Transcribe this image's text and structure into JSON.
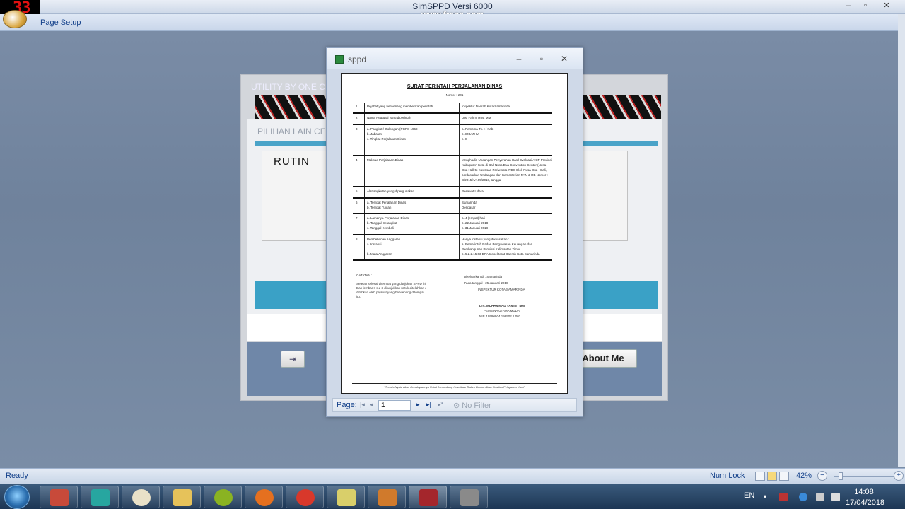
{
  "app": {
    "title": "SimSPPD Versi 6000",
    "overlay": "www.fraps.com",
    "fps": "33",
    "ribbon_tab": "Page Setup"
  },
  "window_controls": {
    "minimize": "–",
    "restore": "▫",
    "close": "✕"
  },
  "background_form": {
    "title": "UTILITY BY ONE CLIC",
    "subtitle": "PILIHAN LAIN CETA",
    "rutin": "RUTIN",
    "about": "About Me"
  },
  "report_window": {
    "title": "sppd",
    "nav": {
      "page_label": "Page:",
      "page_value": "1",
      "filter": "No Filter"
    },
    "document": {
      "title": "SURAT PERINTAH PERJALANAN DINAS",
      "nomor": "Nomor :  201",
      "rows": [
        {
          "no": "1",
          "label": "Pejabat yang berwenang memberikan perintah",
          "value": "Inspektur Daerah Kota Samarinda"
        },
        {
          "no": "2",
          "label": "Nama Pegawai yang diperintah",
          "value": "Drs. Fahmi Ros, MM"
        },
        {
          "no": "3",
          "label": "a. Pangkat / Golongan (PGPS-1968 \nb. Jabatan\nc. Tingkat Perjalanan Dinas",
          "value": "a.   Pembina Tk. I / IV/b\nb.   IRBAN IV\nc.   C"
        },
        {
          "no": "4",
          "label": "Maksud Perjalanan Dinas",
          "value": "Menghadiri Undangan Penyerahan Hasil Evaluasi AKIP Provinsi Kabupaten Kota di Bali Nusa Dua Convention Center (Nusa Dua Hall 5) Kawasan Pariwisata ITDC Blok Nusa Dua - Bali, berdasarkan Undangan dari Kementerian PAN & RB Nomor : B/2015/AA.05/2018, tanggal"
        },
        {
          "no": "5",
          "label": "Alat angkutan yang dipergunakan",
          "value": "Pesawat Udara"
        },
        {
          "no": "6",
          "label": "a. Tempat Perjalanan Dinas\nb. Tempat Tujuan",
          "value": "Samarinda\nDenpasar"
        },
        {
          "no": "7",
          "label": "a. Lamanya Perjalanan Dinas\nb. Tanggal Berangkat\nc. Tanggal Kembali",
          "value": "a.   4   (empat) hari\nb.   22 Januari  2018\nc.   31 Januari  2018"
        },
        {
          "no": "8",
          "label": "Pembebanan Anggaran\n  a. Instansi\n\n  b. Mata Anggaran",
          "value": "Hanya instansi yang dikuasakan :\na.   Pemerintah Badan Pengawasan Keuangan dan Pembangunan Provinsi Kalimantan Timur\nb.   5.2.2.15.03 DPA Inspektorat Daerah Kota Samarinda"
        }
      ],
      "notes": "CATATAN :\n\nSetelah selesai ditempat yang ditujukan SPPD ini Dan lembar II s.d 3 ditunjukkan untuk ditelahkan / ditahkan oleh pejabat yang berwenang ditempat itu.",
      "sign": {
        "issued_at": "Dikeluarkan di :   Samarinda",
        "date": "Pada tanggal :   25 Januari 2018",
        "org": "INSPEKTUR KOTA SAMARINDA",
        "name": "Drs. MUHAMMAD YAMIN , MM",
        "rank": "PEMBINA UTAMA MUDA",
        "nip": "NIP. 19590904 198502 1 002"
      },
      "footer": "\"Tertulis Nyata Akan Kecakapannya Untuk Mendukung Kesetiaan Dalam Bentuk Akan Kualitas Pelayanan Kami\""
    }
  },
  "statusbar": {
    "status": "Ready",
    "numlock": "Num Lock",
    "zoom": "42%",
    "zoom_minus": "−",
    "zoom_plus": "+"
  },
  "taskbar": {
    "lang": "EN",
    "time": "14:08",
    "date": "17/04/2018"
  }
}
